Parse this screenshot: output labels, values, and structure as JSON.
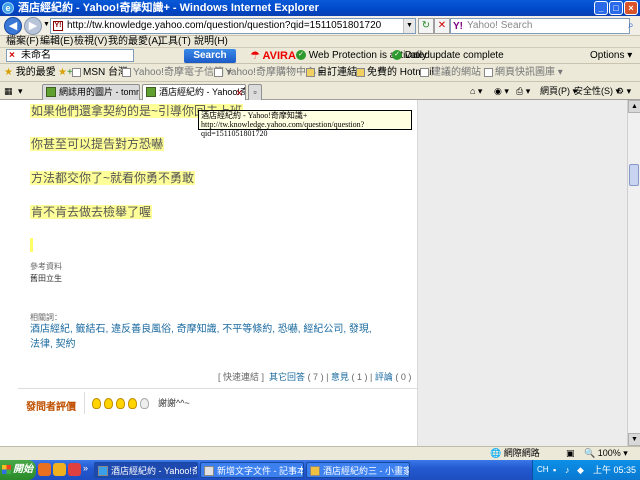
{
  "window": {
    "title": "酒店經紀約 - Yahoo!奇摩知識+ - Windows Internet Explorer",
    "ie_logo": "e",
    "min": "_",
    "max": "□",
    "close": "×"
  },
  "addressbar": {
    "url": "http://tw.knowledge.yahoo.com/question/question?qid=1511051801720",
    "favicon": "Y!",
    "yahoo_search_placeholder": "Yahoo! Search",
    "yahoo_logo": "Y!"
  },
  "menu": {
    "items": [
      "檔案(F)",
      "編輯(E)",
      "檢視(V)",
      "我的最愛(A)",
      "工具(T)",
      "說明(H)"
    ]
  },
  "toolbar": {
    "search_input_value": "未命名",
    "search_button": "Search",
    "avira": "AVIRA",
    "web_protection": "Web Protection is activated",
    "daily_update": "Daily update complete",
    "options": "Options"
  },
  "favorites": {
    "label": "我的最愛",
    "items": [
      "MSN 台灣",
      "Yahoo!奇摩電子信箱",
      "Yahoo!奇摩購物中心",
      "自訂連結",
      "免費的 Hotmail",
      "建議的網站",
      "網頁快訊圖庫"
    ]
  },
  "tabs": {
    "items": [
      "網誌用的圖片 - tommyeaf ...",
      "酒店經紀約 - Yahoo!奇..."
    ],
    "page_menu": "網頁(P)",
    "safety_menu": "安全性(S)"
  },
  "content": {
    "answer_lines": [
      "如果他們還拿契約的是~引導你回去上班",
      "你甚至可以提告對方恐嚇",
      "方法都交你了~就看你勇不勇敢",
      "肯不肯去做去檢舉了喔"
    ],
    "ref_title": "參考資料",
    "ref_value": "舊田立生",
    "tags_title": "相關詞：",
    "tags_line1": "酒店經紀, 籤結石, 違反善良風俗, 奇摩知識, 不平等條約, 恐嚇, 經紀公司, 發現,",
    "tags_line2": "法律, 契約",
    "links": {
      "quick": "[ 快速連結 ]",
      "other_answers": "其它回答",
      "other_count": "( 7 )",
      "opinion": "意見",
      "opinion_count": "( 1 )",
      "comment": "評論",
      "comment_count": "( 0 )"
    },
    "rating_title": "發問者評價",
    "rating": {
      "lit": 4,
      "total": 5
    },
    "thanks": "謝謝^^~"
  },
  "tooltip": {
    "line1": "酒店經紀約 - Yahoo!奇摩知識+",
    "line2": "http://tw.knowledge.yahoo.com/question/question?qid=1511051801720"
  },
  "status": {
    "zone": "網際網路",
    "zoom": "100%"
  },
  "taskbar": {
    "start": "開始",
    "tasks": [
      "酒店經紀約 - Yahoo!奇...",
      "新增文字文件 - 記事本",
      "酒店經紀約三 - 小畫家"
    ],
    "lang": "CH",
    "clock": "上午 05:35"
  }
}
